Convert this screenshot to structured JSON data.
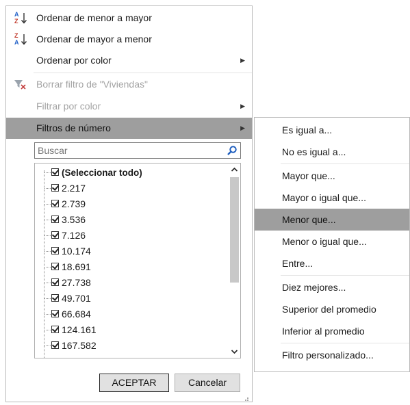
{
  "menu": {
    "items": [
      {
        "label": "Ordenar de menor a mayor",
        "icon": "sort-ascending-icon",
        "disabled": false
      },
      {
        "label": "Ordenar de mayor a menor",
        "icon": "sort-descending-icon",
        "disabled": false
      },
      {
        "label": "Ordenar por color",
        "submenu": true,
        "disabled": false
      },
      {
        "label": "Borrar filtro de \"Viviendas\"",
        "icon": "clear-filter-icon",
        "disabled": true
      },
      {
        "label": "Filtrar por color",
        "submenu": true,
        "disabled": true
      },
      {
        "label": "Filtros de número",
        "submenu": true,
        "highlighted": true
      }
    ],
    "search": {
      "placeholder": "Buscar"
    },
    "values": [
      {
        "label": "(Seleccionar todo)",
        "checked": true
      },
      {
        "label": "2.217",
        "checked": true
      },
      {
        "label": "2.739",
        "checked": true
      },
      {
        "label": "3.536",
        "checked": true
      },
      {
        "label": "7.126",
        "checked": true
      },
      {
        "label": "10.174",
        "checked": true
      },
      {
        "label": "18.691",
        "checked": true
      },
      {
        "label": "27.738",
        "checked": true
      },
      {
        "label": "49.701",
        "checked": true
      },
      {
        "label": "66.684",
        "checked": true
      },
      {
        "label": "124.161",
        "checked": true
      },
      {
        "label": "167.582",
        "checked": true
      }
    ],
    "ok_label": "ACEPTAR",
    "cancel_label": "Cancelar"
  },
  "submenu": {
    "items": [
      {
        "label": "Es igual a..."
      },
      {
        "label": "No es igual a..."
      },
      {
        "label": "Mayor que..."
      },
      {
        "label": "Mayor o igual que..."
      },
      {
        "label": "Menor que...",
        "highlighted": true
      },
      {
        "label": "Menor o igual que..."
      },
      {
        "label": "Entre..."
      },
      {
        "label": "Diez mejores..."
      },
      {
        "label": "Superior del promedio"
      },
      {
        "label": "Inferior al promedio"
      },
      {
        "label": "Filtro personalizado..."
      }
    ]
  },
  "colors": {
    "highlight": "#9e9e9e",
    "disabled_text": "#a3a3a3",
    "search_icon": "#1f5fbf",
    "sort_blue": "#2563c9",
    "sort_red": "#c0392b"
  }
}
